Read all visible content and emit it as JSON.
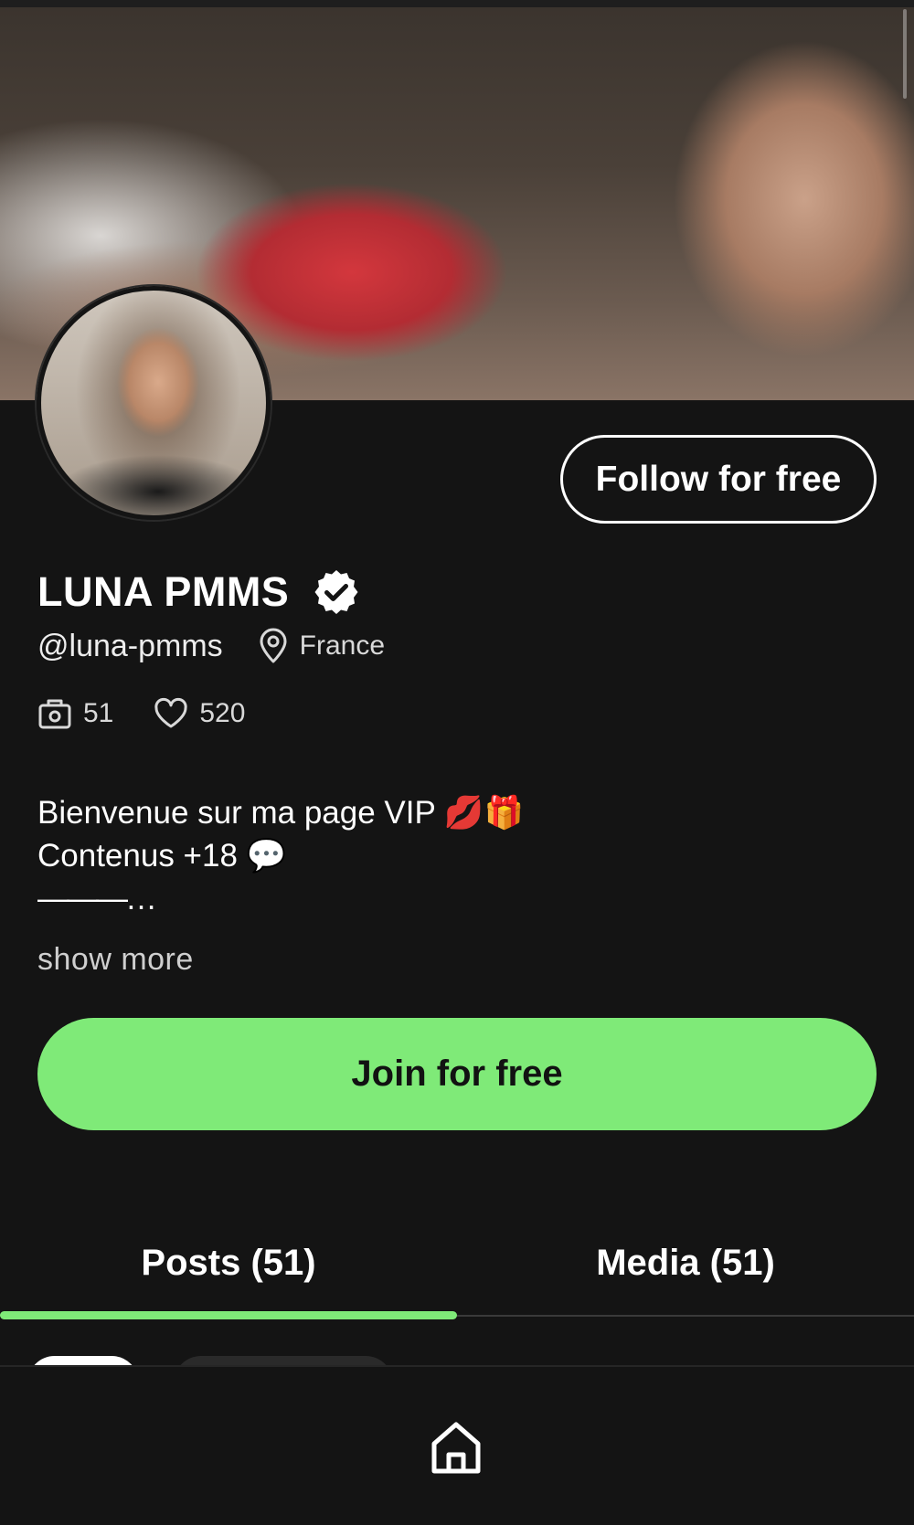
{
  "profile": {
    "display_name": "LUNA PMMS",
    "verified": true,
    "handle": "@luna-pmms",
    "location": "France",
    "stats": {
      "posts_count": "51",
      "likes_count": "520"
    }
  },
  "actions": {
    "follow_label": "Follow for free",
    "join_label": "Join for free",
    "show_more_label": "show more"
  },
  "bio": {
    "line1": "Bienvenue sur ma page VIP 💋🎁",
    "line2": "Contenus +18 💬",
    "line3": "———…"
  },
  "tabs": [
    {
      "label": "Posts (51)",
      "active": true
    },
    {
      "label": "Media (51)",
      "active": false
    }
  ],
  "icons": {
    "verified": "verified-badge-icon",
    "location": "map-pin-icon",
    "posts": "camera-icon",
    "likes": "heart-icon",
    "home": "home-icon"
  },
  "colors": {
    "background": "#141414",
    "accent": "#7fea78",
    "text": "#ffffff"
  }
}
